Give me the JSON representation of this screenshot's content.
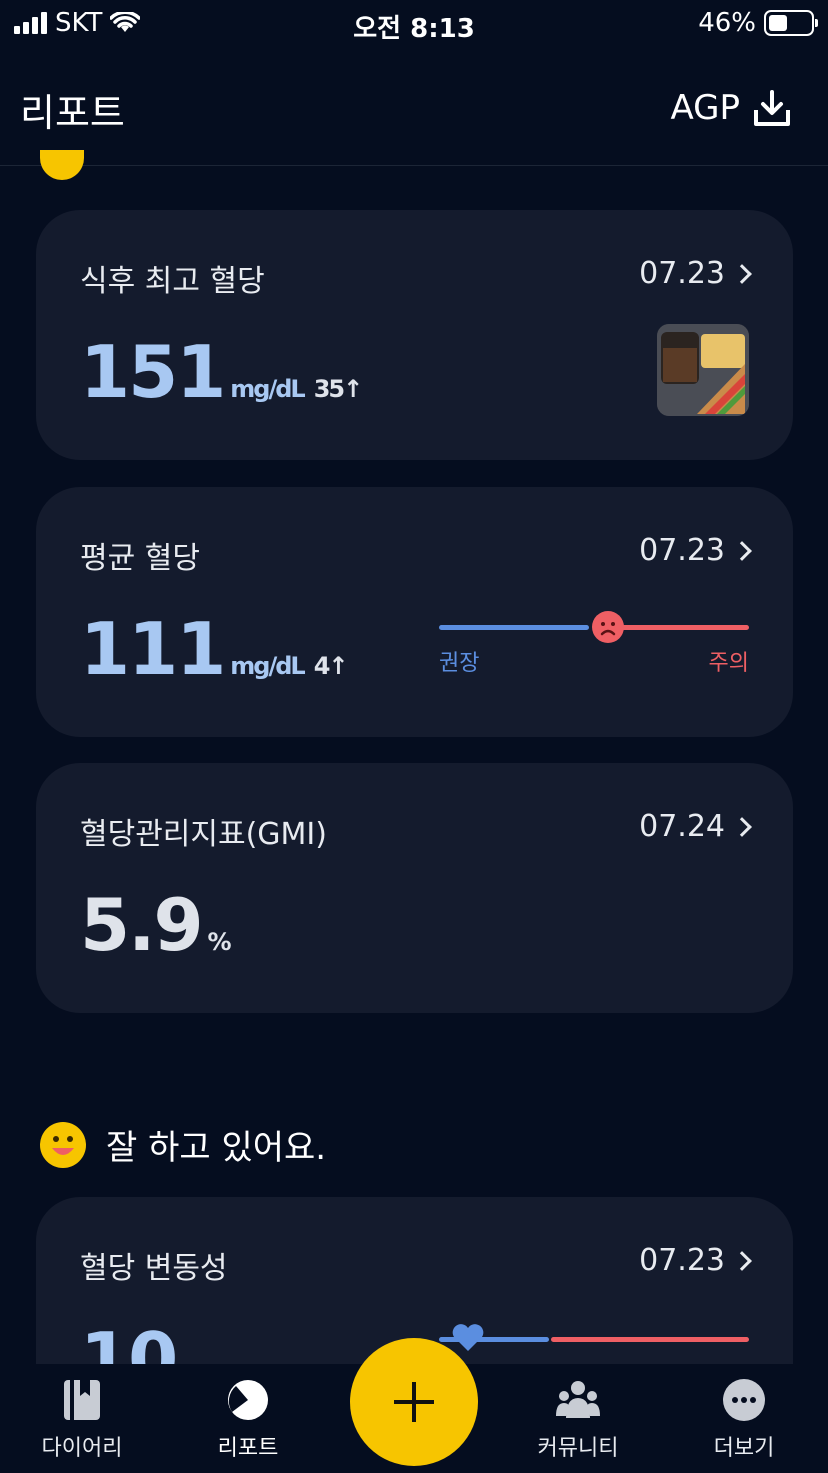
{
  "status_bar": {
    "carrier": "SKT",
    "time": "오전 8:13",
    "battery": "46%",
    "battery_level": 0.46
  },
  "header": {
    "title": "리포트",
    "agp_label": "AGP",
    "agp_icon": "download-icon"
  },
  "cards": {
    "post_meal_peak": {
      "title": "식후 최고 혈당",
      "date": "07.23",
      "value": "151",
      "unit": "mg/dL",
      "delta": "35↑"
    },
    "average_glucose": {
      "title": "평균 혈당",
      "date": "07.23",
      "value": "111",
      "unit": "mg/dL",
      "delta": "4↑",
      "range_left_label": "권장",
      "range_right_label": "주의"
    },
    "gmi": {
      "title": "혈당관리지표(GMI)",
      "date": "07.24",
      "value": "5.9",
      "unit": "%"
    },
    "variability": {
      "title": "혈당 변동성",
      "date": "07.23",
      "value": "10"
    }
  },
  "section": {
    "heading": "잘 하고 있어요."
  },
  "tabbar": {
    "diary": "다이어리",
    "report": "리포트",
    "community": "커뮤니티",
    "more": "더보기"
  },
  "colors": {
    "accent_yellow": "#f7c500",
    "value_blue": "#a8c8f2",
    "range_blue": "#5b8ee0",
    "range_red": "#ef5f64",
    "card_bg": "#141b2d",
    "page_bg": "#050d1f"
  }
}
